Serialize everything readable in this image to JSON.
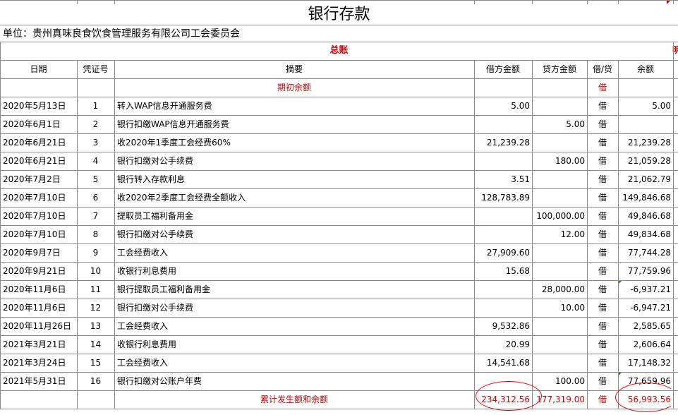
{
  "title": "银行存款",
  "unit_label": "单位：贵州真味良食饮食管理服务有限公司工会委员会",
  "ledger_title": "总账",
  "edge_glyph": "明",
  "columns": {
    "date": "日期",
    "voucher": "凭证号",
    "summary": "摘要",
    "debit": "借方金额",
    "credit": "贷方金额",
    "direction": "借/贷",
    "balance": "余额"
  },
  "opening_row": {
    "summary": "期初余额",
    "direction": "借"
  },
  "rows": [
    {
      "date": "2020年5月13日",
      "voucher": "1",
      "summary": "转入WAP信息开通服务费",
      "debit": "5.00",
      "credit": "",
      "direction": "借",
      "balance": "5.00"
    },
    {
      "date": "2020年6月1日",
      "voucher": "2",
      "summary": "银行扣缴WAP信息开通服务费",
      "debit": "",
      "credit": "5.00",
      "direction": "借",
      "balance": ""
    },
    {
      "date": "2020年6月21日",
      "voucher": "3",
      "summary": "收2020年1季度工会经费60%",
      "debit": "21,239.28",
      "credit": "",
      "direction": "借",
      "balance": "21,239.28"
    },
    {
      "date": "2020年6月21日",
      "voucher": "4",
      "summary": "银行扣缴对公手续费",
      "debit": "",
      "credit": "180.00",
      "direction": "借",
      "balance": "21,059.28"
    },
    {
      "date": "2020年7月2日",
      "voucher": "5",
      "summary": "银行转入存款利息",
      "debit": "3.51",
      "credit": "",
      "direction": "借",
      "balance": "21,062.79"
    },
    {
      "date": "2020年7月10日",
      "voucher": "6",
      "summary": "收2020年2季度工会经费全额收入",
      "debit": "128,783.89",
      "credit": "",
      "direction": "借",
      "balance": "149,846.68"
    },
    {
      "date": "2020年7月10日",
      "voucher": "7",
      "summary": "提取员工福利备用金",
      "debit": "",
      "credit": "100,000.00",
      "direction": "借",
      "balance": "49,846.68"
    },
    {
      "date": "2020年7月10日",
      "voucher": "8",
      "summary": "银行扣缴对公手续费",
      "debit": "",
      "credit": "12.00",
      "direction": "借",
      "balance": "49,834.68"
    },
    {
      "date": "2020年9月7日",
      "voucher": "9",
      "summary": "工会经费收入",
      "debit": "27,909.60",
      "credit": "",
      "direction": "借",
      "balance": "77,744.28"
    },
    {
      "date": "2020年9月21日",
      "voucher": "10",
      "summary": "收银行利息费用",
      "debit": "15.68",
      "credit": "",
      "direction": "借",
      "balance": "77,759.96"
    },
    {
      "date": "2020年11月6日",
      "voucher": "11",
      "summary": "银行提取员工福利备用金",
      "debit": "",
      "credit": "28,000.00",
      "direction": "借",
      "balance": "-6,937.21"
    },
    {
      "date": "2020年11月6日",
      "voucher": "12",
      "summary": "银行扣缴对公手续费",
      "debit": "",
      "credit": "10.00",
      "direction": "借",
      "balance": "-6,947.21"
    },
    {
      "date": "2020年11月26日",
      "voucher": "13",
      "summary": "工会经费收入",
      "debit": "9,532.86",
      "credit": "",
      "direction": "借",
      "balance": "2,585.65"
    },
    {
      "date": "2021年3月21日",
      "voucher": "14",
      "summary": "收银行利息费用",
      "debit": "20.99",
      "credit": "",
      "direction": "借",
      "balance": "2,606.64"
    },
    {
      "date": "2021年3月24日",
      "voucher": "15",
      "summary": "工会经费收入",
      "debit": "14,541.68",
      "credit": "",
      "direction": "借",
      "balance": "17,148.32"
    },
    {
      "date": "2021年5月31日",
      "voucher": "16",
      "summary": "银行扣缴对公账户年费",
      "debit": "",
      "credit": "100.00",
      "direction": "借",
      "balance": "77,659.96"
    }
  ],
  "total_row": {
    "summary": "累计发生额和余额",
    "debit": "234,312.56",
    "credit": "177,319.00",
    "direction": "借",
    "balance": "56,993.56"
  },
  "colors": {
    "red_text": "#d40000",
    "grid": "#8c8c8c",
    "annotation_circle": "#ff0000",
    "cell_marker": "#1e8a1e"
  }
}
